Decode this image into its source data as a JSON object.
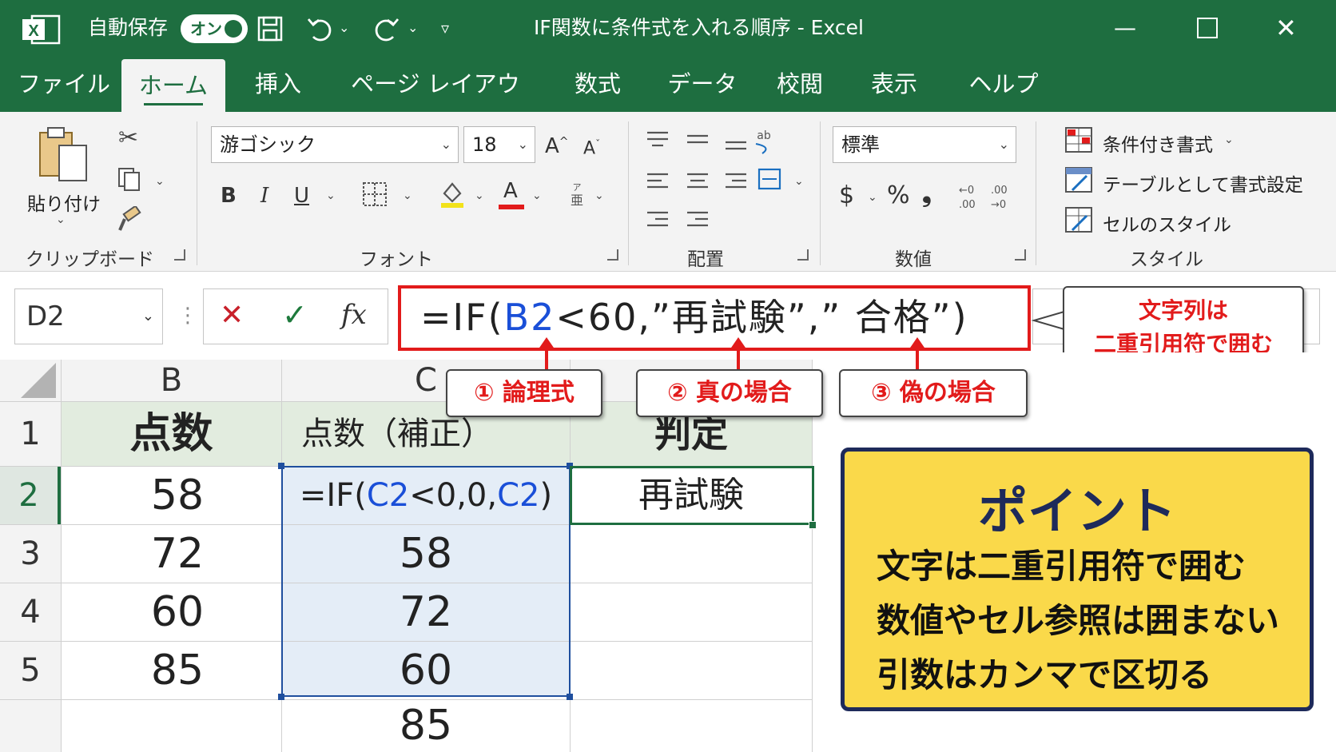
{
  "titlebar": {
    "autosave_label": "自動保存",
    "autosave_state": "オン",
    "title": "IF関数に条件式を入れる順序 - Excel",
    "app_icon": "excel-icon"
  },
  "tabs": [
    "ファイル",
    "ホーム",
    "挿入",
    "ページ レイアウト",
    "数式",
    "データ",
    "校閲",
    "表示",
    "ヘルプ"
  ],
  "ribbon": {
    "clipboard": {
      "label": "クリップボード",
      "paste": "貼り付け"
    },
    "font": {
      "label": "フォント",
      "font_name": "游ゴシック",
      "font_size": "18",
      "grow": "A",
      "shrink": "A",
      "bold": "B",
      "italic": "I",
      "underline": "U",
      "font_color": "A"
    },
    "alignment": {
      "label": "配置"
    },
    "number": {
      "label": "数値",
      "format": "標準",
      "currency": "$",
      "percent": "%",
      "comma": "❟"
    },
    "styles": {
      "label": "スタイル",
      "conditional": "条件付き書式",
      "table": "テーブルとして書式設定",
      "cell_styles": "セルのスタイル"
    }
  },
  "formula_bar": {
    "name_box": "D2",
    "cancel": "✕",
    "enter": "✓",
    "fx": "fx",
    "formula_parts": [
      "=IF(",
      "B2",
      "<60,”再試験”,” 合格”)"
    ]
  },
  "callouts": {
    "quote_note_1": "文字列は",
    "quote_note_2": "二重引用符で囲む",
    "arg1": "① 論理式",
    "arg2": "② 真の場合",
    "arg3": "③ 偽の場合"
  },
  "sheet": {
    "columns": [
      "B",
      "C"
    ],
    "rows": [
      "1",
      "2",
      "3",
      "4",
      "5"
    ],
    "header_b": "点数",
    "header_c": "点数（補正）",
    "header_d": "判定",
    "b_values": [
      "58",
      "72",
      "60",
      "85"
    ],
    "c2_parts": [
      "=IF(",
      "C2",
      "<0,0,",
      "C2",
      ")"
    ],
    "c_values": [
      "58",
      "72",
      "60",
      "85"
    ],
    "d2": "再試験"
  },
  "point": {
    "title": "ポイント",
    "lines": [
      "文字は二重引用符で囲む",
      "数値やセル参照は囲まない",
      "引数はカンマで区切る"
    ]
  },
  "colors": {
    "excel_green": "#1e6e40",
    "highlight_red": "#e21b1b",
    "point_yellow": "#fad94a",
    "navy": "#1e2a5a",
    "ref_blue": "#1a4fd8"
  }
}
